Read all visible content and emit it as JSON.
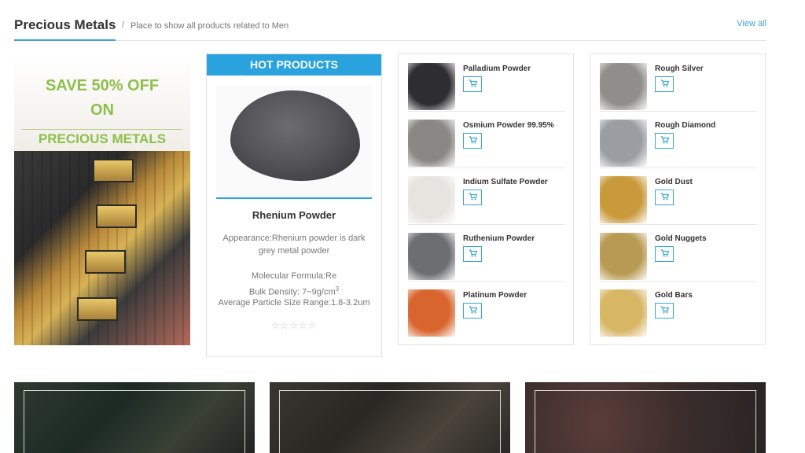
{
  "header": {
    "title": "Precious Metals",
    "separator": "/",
    "subtitle": "Place to show all products related to Men",
    "view_all": "View all"
  },
  "banner": {
    "line1": "SAVE 50% OFF",
    "line2": "ON",
    "line3": "PRECIOUS METALS"
  },
  "hot_products": {
    "ribbon": "HOT PRODUCTS",
    "name": "Rhenium Powder",
    "appearance": "Appearance:Rhenium powder is dark grey metal powder",
    "formula": "Molecular Formula:Re",
    "density": "Bulk Density: 7~9g/cm",
    "density_sup": "3",
    "particle": "Average Particle Size Range:1.8-3.2um",
    "rating": 0,
    "rating_max": 5
  },
  "lists": [
    {
      "items": [
        {
          "name": "Palladium Powder",
          "thumb": "#2e2e31"
        },
        {
          "name": "Osmium Powder 99.95%",
          "thumb": "#8a8884"
        },
        {
          "name": "Indium Sulfate Powder",
          "thumb": "#e6e4df"
        },
        {
          "name": "Ruthenium Powder",
          "thumb": "#6d6e72"
        },
        {
          "name": "Platinum Powder",
          "thumb": "#d8652d"
        }
      ]
    },
    {
      "items": [
        {
          "name": "Rough Silver",
          "thumb": "#8f8e8a"
        },
        {
          "name": "Rough Diamond",
          "thumb": "#9a9ea2"
        },
        {
          "name": "Gold Dust",
          "thumb": "#c99a3c"
        },
        {
          "name": "Gold Nuggets",
          "thumb": "#b89a52"
        },
        {
          "name": "Gold Bars",
          "thumb": "#d7b664"
        }
      ]
    }
  ],
  "icons": {
    "cart": "shopping-cart-icon",
    "star": "star-outline-icon"
  },
  "colors": {
    "accent": "#2aa2dd",
    "banner_text": "#8cc04a"
  }
}
